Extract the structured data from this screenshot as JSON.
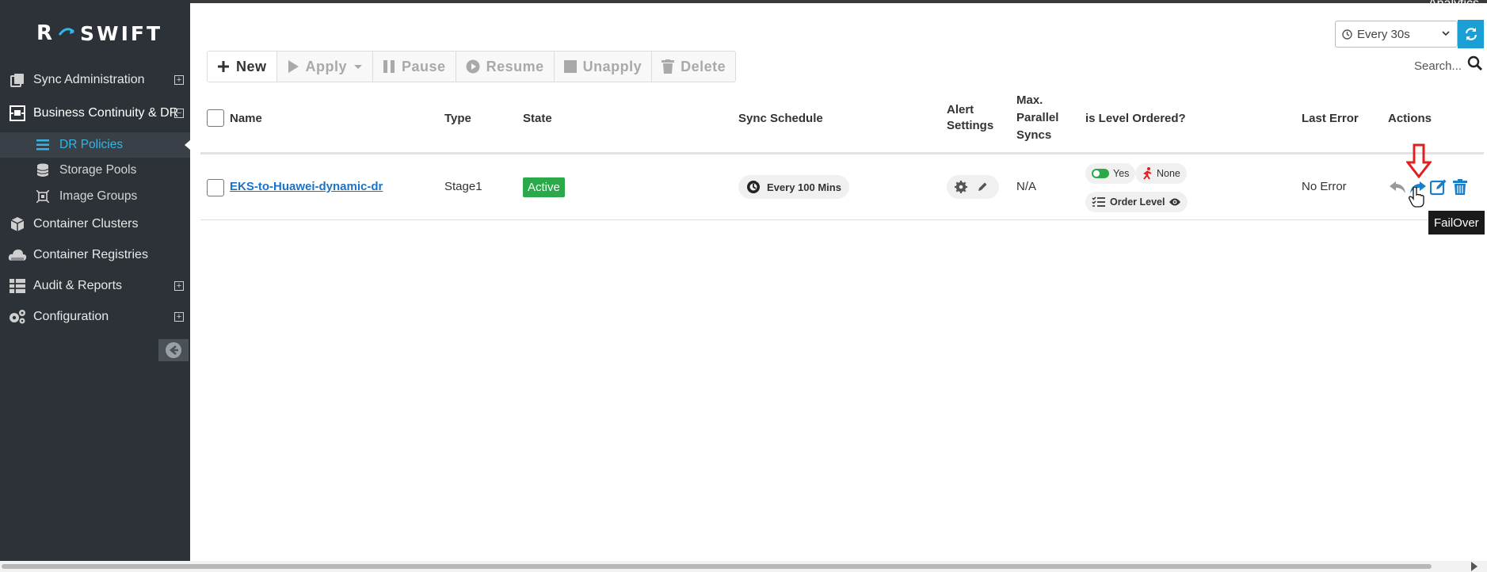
{
  "app": {
    "brand_r": "R",
    "brand_name": "SWIFT",
    "analytics_label": "Analytics"
  },
  "sidebar": {
    "items": [
      {
        "label": "Sync Administration",
        "icon": "copy-icon",
        "expandable": true
      },
      {
        "label": "Business Continuity & DR",
        "icon": "dr-icon",
        "expanded": true
      },
      {
        "label": "Container Clusters",
        "icon": "cube-icon"
      },
      {
        "label": "Container Registries",
        "icon": "cloud-icon"
      },
      {
        "label": "Audit & Reports",
        "icon": "table-icon",
        "expandable": true
      },
      {
        "label": "Configuration",
        "icon": "cogs-icon",
        "expandable": true
      }
    ],
    "subitems": [
      {
        "label": "DR Policies",
        "icon": "list-icon",
        "selected": true
      },
      {
        "label": "Storage Pools",
        "icon": "database-icon"
      },
      {
        "label": "Image Groups",
        "icon": "image-group-icon"
      }
    ]
  },
  "topbar": {
    "refresh_interval": "Every 30s",
    "search_placeholder": "Search..."
  },
  "toolbar": {
    "new": "New",
    "apply": "Apply",
    "pause": "Pause",
    "resume": "Resume",
    "unapply": "Unapply",
    "delete": "Delete"
  },
  "table": {
    "columns": {
      "name": "Name",
      "type": "Type",
      "state": "State",
      "schedule": "Sync Schedule",
      "alert_1": "Alert",
      "alert_2": "Settings",
      "max_1": "Max.",
      "max_2": "Parallel",
      "max_3": "Syncs",
      "level": "is Level Ordered?",
      "last_error": "Last Error",
      "actions": "Actions"
    },
    "rows": [
      {
        "name": "EKS-to-Huawei-dynamic-dr",
        "type": "Stage1",
        "state": "Active",
        "schedule": "Every 100 Mins",
        "max_parallel": "N/A",
        "level_yes": "Yes",
        "level_none": "None",
        "order_level": "Order Level",
        "last_error": "No Error"
      }
    ]
  },
  "tooltip": "FailOver",
  "colors": {
    "accent": "#1a9fd5",
    "active_green": "#2aa84a",
    "sidebar_bg": "#2d3238",
    "selected_text": "#33b5e5",
    "annotation_red": "#e02020"
  }
}
